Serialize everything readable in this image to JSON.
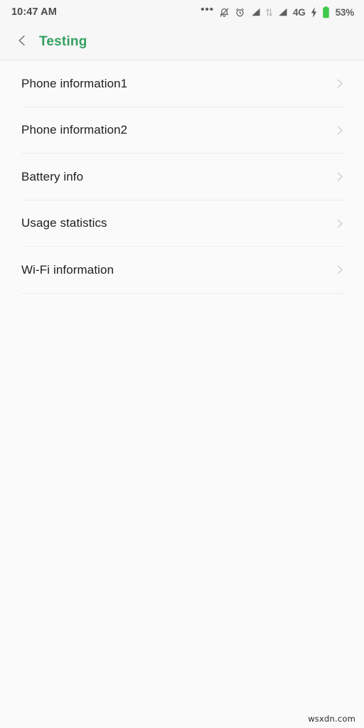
{
  "status_bar": {
    "time": "10:47 AM",
    "icons": [
      {
        "name": "more-options-icon",
        "glyph": "•••"
      },
      {
        "name": "bell-muted-icon"
      },
      {
        "name": "alarm-clock-icon"
      },
      {
        "name": "signal-bars-sim1-icon"
      },
      {
        "name": "data-transfer-icon"
      },
      {
        "name": "signal-bars-sim2-icon"
      }
    ],
    "network_label": "4G",
    "charging_icon": "charging-bolt-icon",
    "battery_icon": "battery-icon",
    "battery_level": "53%",
    "battery_color": "#3fcb4a",
    "text_color": "#5e5e5e"
  },
  "app_bar": {
    "back_icon": "chevron-left-icon",
    "title": "Testing",
    "title_color": "#34a05f",
    "background": "#f7f7f7"
  },
  "list": {
    "items": [
      {
        "label": "Phone information1",
        "chevron": "chevron-right-icon"
      },
      {
        "label": "Phone information2",
        "chevron": "chevron-right-icon"
      },
      {
        "label": "Battery info",
        "chevron": "chevron-right-icon"
      },
      {
        "label": "Usage statistics",
        "chevron": "chevron-right-icon"
      },
      {
        "label": "Wi-Fi information",
        "chevron": "chevron-right-icon"
      }
    ]
  },
  "watermark": {
    "text": "wsxdn.com"
  }
}
